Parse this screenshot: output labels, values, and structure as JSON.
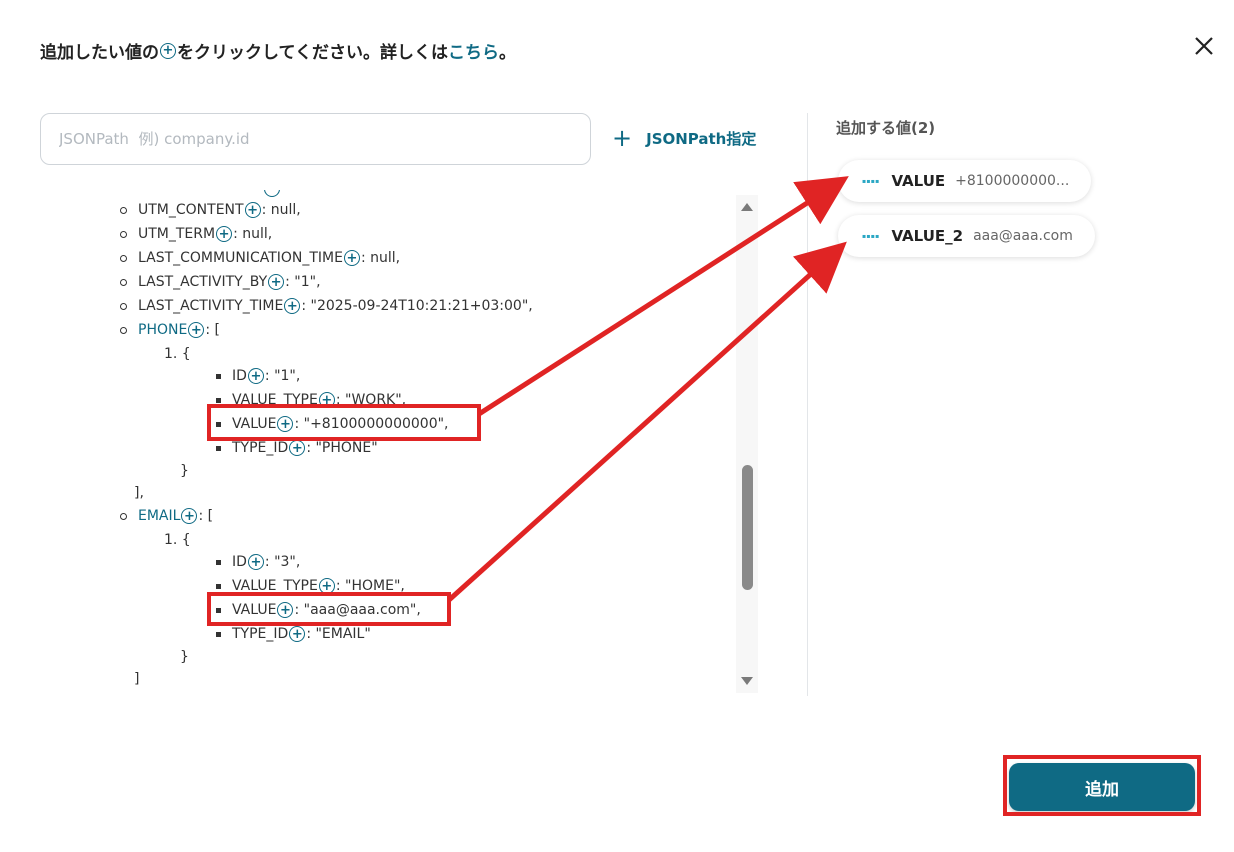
{
  "header": {
    "prefix": "追加したい値の",
    "suffix": "をクリックしてください。詳しくは",
    "link": "こちら",
    "period": "。"
  },
  "search": {
    "placeholder": "JSONPath  例) company.id"
  },
  "jsonpath_button": {
    "label": "JSONPath指定"
  },
  "tree": {
    "lines": [
      {
        "key": "UTM_CONTENT",
        "rest": ": null,"
      },
      {
        "key": "UTM_TERM",
        "rest": ": null,"
      },
      {
        "key": "LAST_COMMUNICATION_TIME",
        "rest": ": null,"
      },
      {
        "key": "LAST_ACTIVITY_BY",
        "rest": ": \"1\","
      },
      {
        "key": "LAST_ACTIVITY_TIME",
        "rest": ": \"2025-09-24T10:21:21+03:00\","
      },
      {
        "key": "PHONE",
        "rest": ": ["
      },
      {
        "text": "1. {"
      },
      {
        "key": "ID",
        "rest": ": \"1\","
      },
      {
        "key": "VALUE_TYPE",
        "rest": ": \"WORK\","
      },
      {
        "key": "VALUE",
        "rest": ": \"+8100000000000\","
      },
      {
        "key": "TYPE_ID",
        "rest": ": \"PHONE\""
      },
      {
        "text": "}"
      },
      {
        "text": "],"
      },
      {
        "key": "EMAIL",
        "rest": ": ["
      },
      {
        "text": "1. {"
      },
      {
        "key": "ID",
        "rest": ": \"3\","
      },
      {
        "key": "VALUE_TYPE",
        "rest": ": \"HOME\","
      },
      {
        "key": "VALUE",
        "rest": ": \"aaa@aaa.com\","
      },
      {
        "key": "TYPE_ID",
        "rest": ": \"EMAIL\""
      },
      {
        "text": "}"
      },
      {
        "text": "]"
      }
    ]
  },
  "panel": {
    "title": "追加する値(2)",
    "items": [
      {
        "name": "VALUE",
        "value": "+8100000000..."
      },
      {
        "name": "VALUE_2",
        "value": "aaa@aaa.com"
      }
    ]
  },
  "add_button": {
    "label": "追加"
  },
  "colors": {
    "accent": "#0f6a84",
    "annotation": "#e02424"
  }
}
